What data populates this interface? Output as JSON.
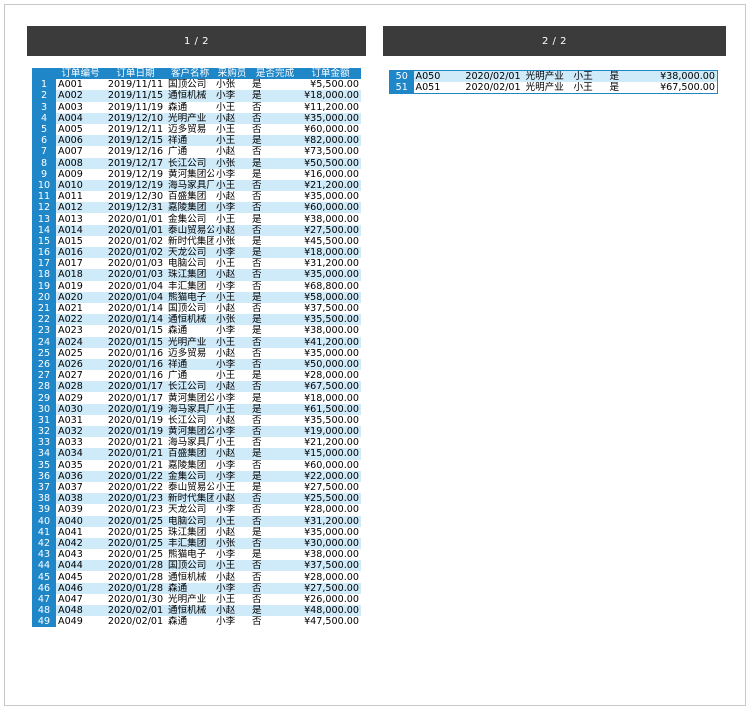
{
  "pages": {
    "page1_label": "1 / 2",
    "page2_label": "2 / 2"
  },
  "columns": [
    "订单编号",
    "订单日期",
    "客户名称",
    "采购员",
    "是否完成",
    "订单金额"
  ],
  "rows": [
    [
      "1",
      "A001",
      "2019/11/11",
      "国顶公司",
      "小张",
      "是",
      "¥5,500.00"
    ],
    [
      "2",
      "A002",
      "2019/11/15",
      "通恒机械",
      "小李",
      "是",
      "¥18,000.00"
    ],
    [
      "3",
      "A003",
      "2019/11/19",
      "森通",
      "小王",
      "否",
      "¥11,200.00"
    ],
    [
      "4",
      "A004",
      "2019/12/10",
      "光明产业",
      "小赵",
      "否",
      "¥35,000.00"
    ],
    [
      "5",
      "A005",
      "2019/12/11",
      "迈多贸易",
      "小王",
      "否",
      "¥60,000.00"
    ],
    [
      "6",
      "A006",
      "2019/12/15",
      "祥通",
      "小王",
      "是",
      "¥82,000.00"
    ],
    [
      "7",
      "A007",
      "2019/12/16",
      "广通",
      "小赵",
      "否",
      "¥73,500.00"
    ],
    [
      "8",
      "A008",
      "2019/12/17",
      "长江公司",
      "小张",
      "是",
      "¥50,500.00"
    ],
    [
      "9",
      "A009",
      "2019/12/19",
      "黄河集团公",
      "小李",
      "是",
      "¥16,000.00"
    ],
    [
      "10",
      "A010",
      "2019/12/19",
      "海马家具厂",
      "小王",
      "否",
      "¥21,200.00"
    ],
    [
      "11",
      "A011",
      "2019/12/30",
      "百盛集团",
      "小赵",
      "否",
      "¥35,000.00"
    ],
    [
      "12",
      "A012",
      "2019/12/31",
      "嘉陵集团",
      "小李",
      "否",
      "¥60,000.00"
    ],
    [
      "13",
      "A013",
      "2020/01/01",
      "金集公司",
      "小王",
      "是",
      "¥38,000.00"
    ],
    [
      "14",
      "A014",
      "2020/01/01",
      "泰山贸易公",
      "小赵",
      "否",
      "¥27,500.00"
    ],
    [
      "15",
      "A015",
      "2020/01/02",
      "新时代集团",
      "小张",
      "是",
      "¥45,500.00"
    ],
    [
      "16",
      "A016",
      "2020/01/02",
      "天龙公司",
      "小李",
      "是",
      "¥18,000.00"
    ],
    [
      "17",
      "A017",
      "2020/01/03",
      "电脑公司",
      "小王",
      "否",
      "¥31,200.00"
    ],
    [
      "18",
      "A018",
      "2020/01/03",
      "珠江集团",
      "小赵",
      "否",
      "¥35,000.00"
    ],
    [
      "19",
      "A019",
      "2020/01/04",
      "丰汇集团",
      "小李",
      "否",
      "¥68,800.00"
    ],
    [
      "20",
      "A020",
      "2020/01/04",
      "熊猫电子",
      "小王",
      "是",
      "¥58,000.00"
    ],
    [
      "21",
      "A021",
      "2020/01/14",
      "国顶公司",
      "小赵",
      "否",
      "¥37,500.00"
    ],
    [
      "22",
      "A022",
      "2020/01/14",
      "通恒机械",
      "小张",
      "是",
      "¥35,500.00"
    ],
    [
      "23",
      "A023",
      "2020/01/15",
      "森通",
      "小李",
      "是",
      "¥38,000.00"
    ],
    [
      "24",
      "A024",
      "2020/01/15",
      "光明产业",
      "小王",
      "否",
      "¥41,200.00"
    ],
    [
      "25",
      "A025",
      "2020/01/16",
      "迈多贸易",
      "小赵",
      "否",
      "¥35,000.00"
    ],
    [
      "26",
      "A026",
      "2020/01/16",
      "祥通",
      "小李",
      "否",
      "¥50,000.00"
    ],
    [
      "27",
      "A027",
      "2020/01/16",
      "广通",
      "小王",
      "是",
      "¥28,000.00"
    ],
    [
      "28",
      "A028",
      "2020/01/17",
      "长江公司",
      "小赵",
      "否",
      "¥67,500.00"
    ],
    [
      "29",
      "A029",
      "2020/01/17",
      "黄河集团公",
      "小李",
      "是",
      "¥18,000.00"
    ],
    [
      "30",
      "A030",
      "2020/01/19",
      "海马家具厂",
      "小王",
      "是",
      "¥61,500.00"
    ],
    [
      "31",
      "A031",
      "2020/01/19",
      "长江公司",
      "小赵",
      "否",
      "¥35,500.00"
    ],
    [
      "32",
      "A032",
      "2020/01/19",
      "黄河集团公",
      "小李",
      "否",
      "¥19,000.00"
    ],
    [
      "33",
      "A033",
      "2020/01/21",
      "海马家具厂",
      "小王",
      "否",
      "¥21,200.00"
    ],
    [
      "34",
      "A034",
      "2020/01/21",
      "百盛集团",
      "小赵",
      "是",
      "¥15,000.00"
    ],
    [
      "35",
      "A035",
      "2020/01/21",
      "嘉陵集团",
      "小李",
      "否",
      "¥60,000.00"
    ],
    [
      "36",
      "A036",
      "2020/01/22",
      "金集公司",
      "小李",
      "是",
      "¥22,000.00"
    ],
    [
      "37",
      "A037",
      "2020/01/22",
      "泰山贸易公",
      "小王",
      "是",
      "¥27,500.00"
    ],
    [
      "38",
      "A038",
      "2020/01/23",
      "新时代集团",
      "小赵",
      "否",
      "¥25,500.00"
    ],
    [
      "39",
      "A039",
      "2020/01/23",
      "天龙公司",
      "小李",
      "否",
      "¥28,000.00"
    ],
    [
      "40",
      "A040",
      "2020/01/25",
      "电脑公司",
      "小王",
      "否",
      "¥31,200.00"
    ],
    [
      "41",
      "A041",
      "2020/01/25",
      "珠江集团",
      "小赵",
      "是",
      "¥35,000.00"
    ],
    [
      "42",
      "A042",
      "2020/01/25",
      "丰汇集团",
      "小张",
      "否",
      "¥30,000.00"
    ],
    [
      "43",
      "A043",
      "2020/01/25",
      "熊猫电子",
      "小李",
      "是",
      "¥38,000.00"
    ],
    [
      "44",
      "A044",
      "2020/01/28",
      "国顶公司",
      "小王",
      "否",
      "¥37,500.00"
    ],
    [
      "45",
      "A045",
      "2020/01/28",
      "通恒机械",
      "小赵",
      "否",
      "¥28,000.00"
    ],
    [
      "46",
      "A046",
      "2020/01/28",
      "森通",
      "小李",
      "否",
      "¥27,500.00"
    ],
    [
      "47",
      "A047",
      "2020/01/30",
      "光明产业",
      "小王",
      "否",
      "¥26,000.00"
    ],
    [
      "48",
      "A048",
      "2020/02/01",
      "通恒机械",
      "小赵",
      "是",
      "¥48,000.00"
    ],
    [
      "49",
      "A049",
      "2020/02/01",
      "森通",
      "小李",
      "否",
      "¥47,500.00"
    ],
    [
      "50",
      "A050",
      "2020/02/01",
      "光明产业",
      "小王",
      "是",
      "¥38,000.00"
    ],
    [
      "51",
      "A051",
      "2020/02/01",
      "光明产业",
      "小王",
      "是",
      "¥67,500.00"
    ]
  ],
  "colors": {
    "header_bar": "#3b3b3b",
    "table_header": "#1f86c8",
    "stripe": "#cfeaf9"
  }
}
